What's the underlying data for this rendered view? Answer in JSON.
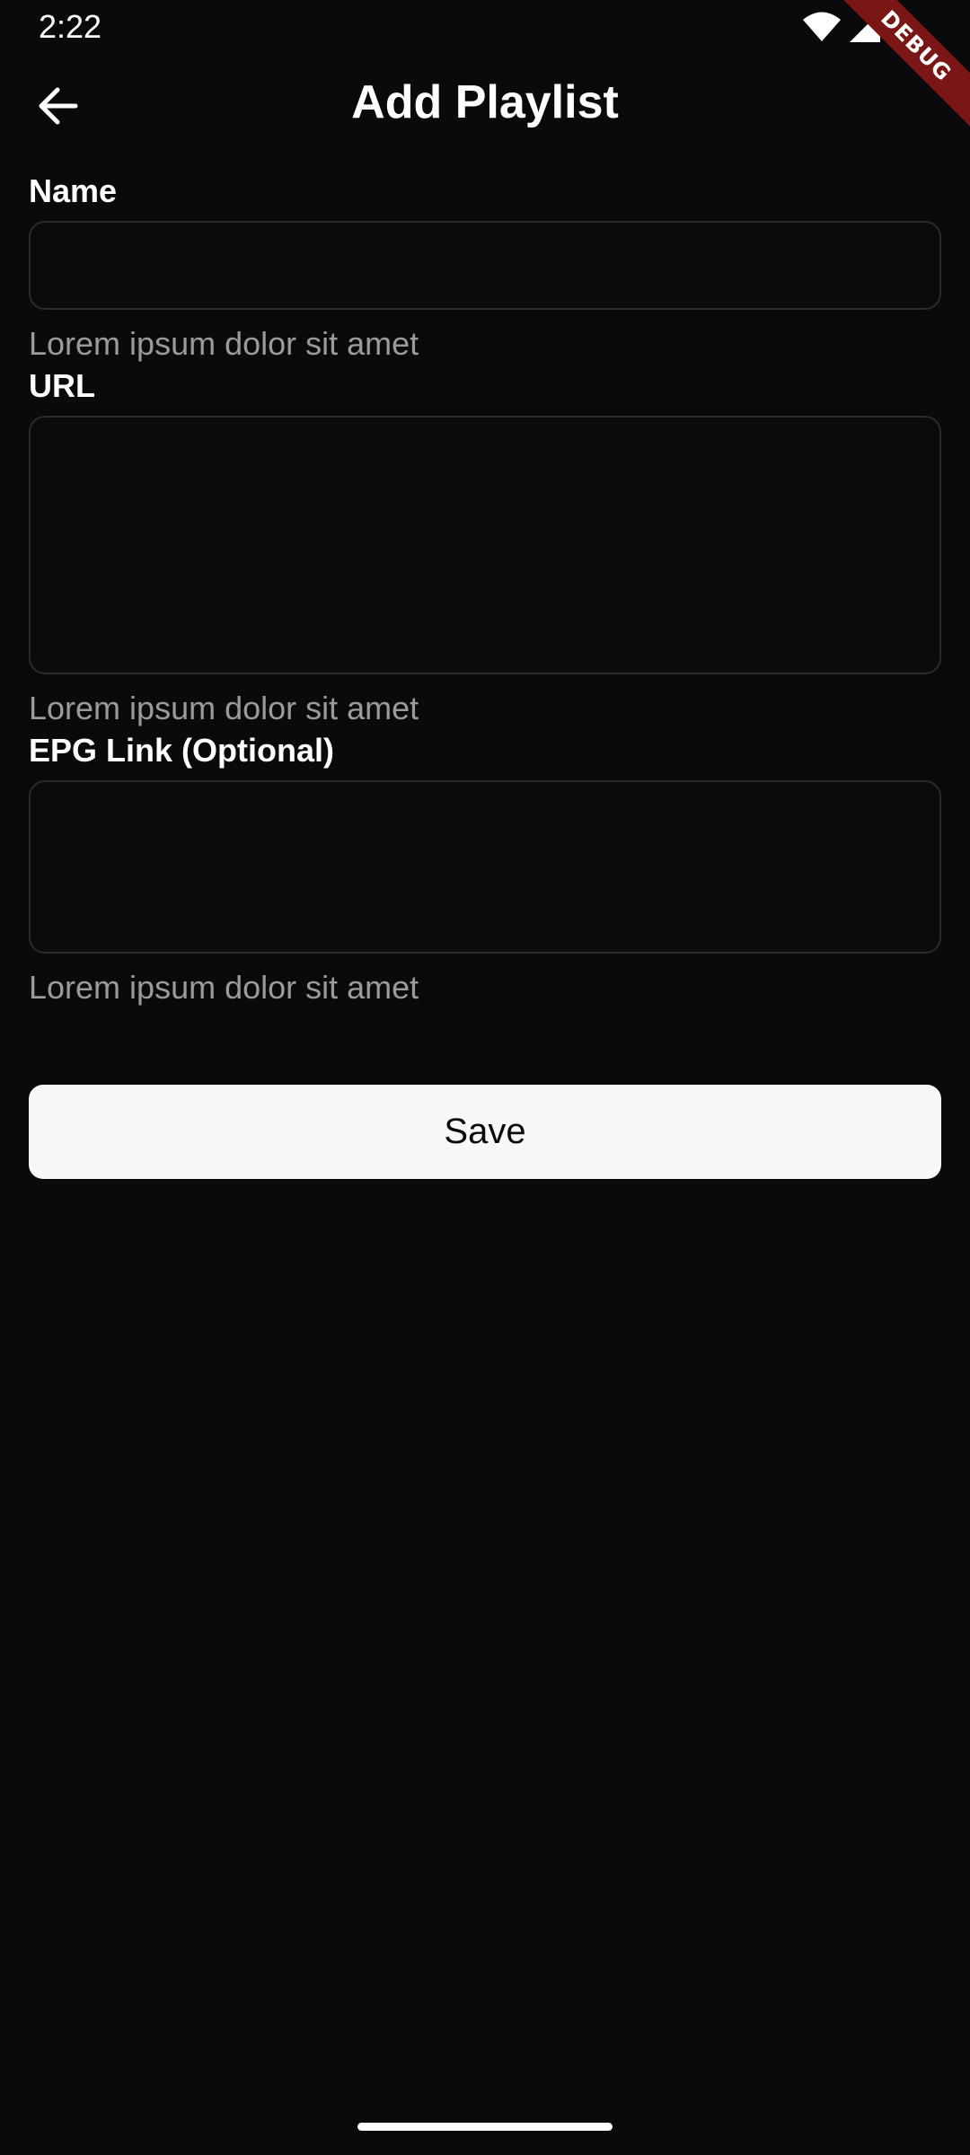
{
  "status_bar": {
    "time": "2:22",
    "icons": [
      "wifi-icon",
      "signal-icon",
      "battery-icon"
    ]
  },
  "debug_banner": {
    "label": "DEBUG",
    "color": "#7a1616"
  },
  "app_bar": {
    "title": "Add Playlist",
    "back_icon": "arrow-left-icon"
  },
  "form": {
    "name": {
      "label": "Name",
      "value": "",
      "help": "Lorem ipsum dolor sit amet"
    },
    "url": {
      "label": "URL",
      "value": "",
      "help": "Lorem ipsum dolor sit amet"
    },
    "epg": {
      "label": "EPG Link (Optional)",
      "value": "",
      "help": "Lorem ipsum dolor sit amet"
    },
    "save_label": "Save"
  },
  "colors": {
    "background": "#0a0a0c",
    "field_border": "#2b2b2f",
    "help_text": "#9a9a9f",
    "button_background": "#f8f8f8",
    "button_text": "#0a0a0c"
  }
}
